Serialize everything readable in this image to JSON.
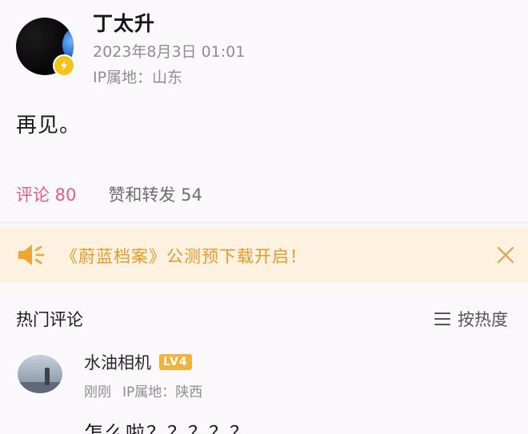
{
  "post": {
    "author": "丁太升",
    "time": "2023年8月3日 01:01",
    "ip_location": "IP属地：山东",
    "content": "再见。"
  },
  "tabs": [
    {
      "label": "评论 80",
      "active": true
    },
    {
      "label": "赞和转发 54",
      "active": false
    }
  ],
  "notice": {
    "text": "《蔚蓝档案》公测预下载开启！",
    "icon": "megaphone-icon",
    "close_icon": "close-icon"
  },
  "hot_comments": {
    "title": "热门评论",
    "sort_label": "按热度",
    "sort_icon": "list-sort-icon",
    "comments": [
      {
        "user": "水油相机",
        "level": "LV4",
        "time": "刚刚",
        "ip_location": "IP属地：陕西",
        "text": "怎么啦？？？？？"
      }
    ]
  },
  "colors": {
    "accent": "#e05a8c",
    "notice_bg": "#fdf1df",
    "notice_text": "#e89a2c",
    "vip_badge": "#f5c21a",
    "level_badge": "#f0b43c"
  }
}
